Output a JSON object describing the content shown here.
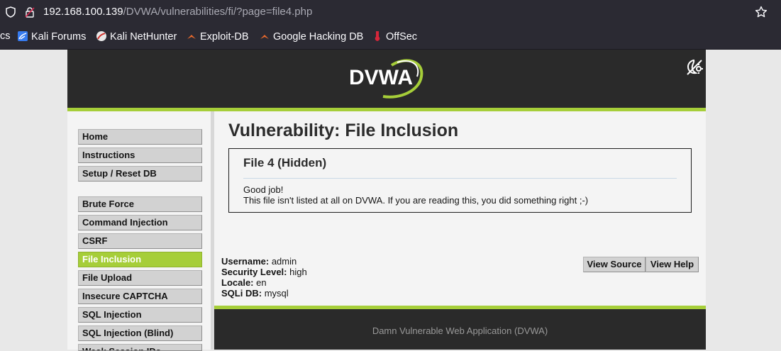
{
  "browser": {
    "url_host": "192.168.100.139",
    "url_path": "/DVWA/vulnerabilities/fi/?page=file4.php",
    "bookmarks": [
      {
        "label": "cs",
        "icon": "none"
      },
      {
        "label": "Kali Forums",
        "icon": "kali-forums-icon"
      },
      {
        "label": "Kali NetHunter",
        "icon": "nethunter-icon"
      },
      {
        "label": "Exploit-DB",
        "icon": "exploitdb-icon"
      },
      {
        "label": "Google Hacking DB",
        "icon": "ghdb-icon"
      },
      {
        "label": "OffSec",
        "icon": "offsec-icon"
      }
    ]
  },
  "header": {
    "logo_text": "DVWA"
  },
  "menu": {
    "items": [
      {
        "label": "Home"
      },
      {
        "label": "Instructions"
      },
      {
        "label": "Setup / Reset DB"
      },
      {
        "label": "Brute Force"
      },
      {
        "label": "Command Injection"
      },
      {
        "label": "CSRF"
      },
      {
        "label": "File Inclusion",
        "active": true
      },
      {
        "label": "File Upload"
      },
      {
        "label": "Insecure CAPTCHA"
      },
      {
        "label": "SQL Injection"
      },
      {
        "label": "SQL Injection (Blind)"
      },
      {
        "label": "Weak Session IDs"
      }
    ]
  },
  "main": {
    "title": "Vulnerability: File Inclusion",
    "box_heading": "File 4 (Hidden)",
    "line1": "Good job!",
    "line2": "This file isn't listed at all on DVWA. If you are reading this, you did something right ;-)"
  },
  "info": {
    "username_label": "Username:",
    "username": "admin",
    "security_label": "Security Level:",
    "security": "high",
    "locale_label": "Locale:",
    "locale": "en",
    "sqlidb_label": "SQLi DB:",
    "sqlidb": "mysql"
  },
  "buttons": {
    "view_source": "View Source",
    "view_help": "View Help"
  },
  "footer": {
    "text": "Damn Vulnerable Web Application (DVWA)"
  },
  "colors": {
    "accent": "#a6ce39",
    "header_bg": "#2a2a2a",
    "browser_bg": "#2b2a33"
  }
}
